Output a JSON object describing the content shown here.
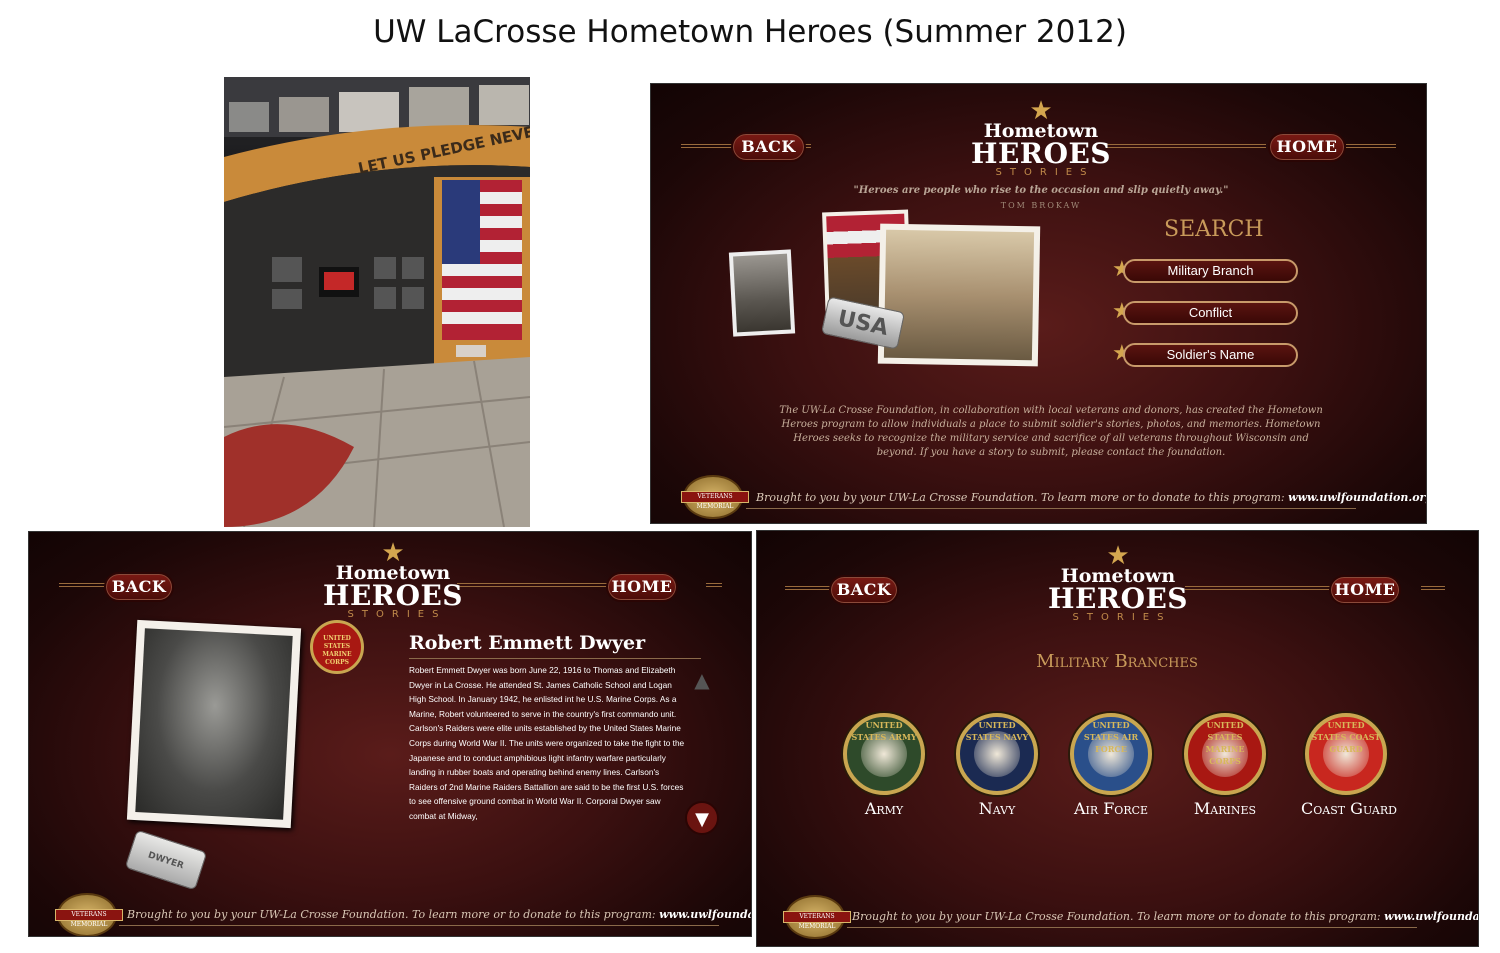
{
  "page_title": "UW LaCrosse Hometown Heroes (Summer 2012)",
  "lobby_photo": {
    "wall_text": "LET US PLEDGE NEVER TO"
  },
  "logo": {
    "line1": "Hometown",
    "line2": "HEROES",
    "line3": "STORIES"
  },
  "nav": {
    "back_label": "BACK",
    "home_label": "HOME"
  },
  "search_screen": {
    "quote": "\"Heroes are people who rise to the occasion and slip quietly away.\"",
    "quote_author": "TOM BROKAW",
    "search_title": "SEARCH",
    "buttons": [
      "Military Branch",
      "Conflict",
      "Soldier's Name"
    ],
    "dog_tag_text": "USA",
    "description": "The UW-La Crosse Foundation, in collaboration with local veterans and donors, has created the Hometown Heroes program to allow individuals a place to submit soldier's stories, photos, and memories. Hometown Heroes seeks to recognize the military service and sacrifice of all veterans throughout Wisconsin and beyond. If you have a story to submit, please contact the foundation."
  },
  "footer": {
    "text": "Brought to you by your UW-La Crosse Foundation. To learn more or to donate to this program:",
    "url": "www.uwlfoundation.org",
    "seal_text": "VETERANS MEMORIAL"
  },
  "bio_screen": {
    "name": "Robert Emmett Dwyer",
    "bio": "Robert Emmett Dwyer was born June 22, 1916 to Thomas and Elizabeth Dwyer in La Crosse. He attended St. James Catholic School and Logan High School. In January 1942, he enlisted int he U.S. Marine Corps. As a Marine, Robert volunteered to serve in the country's first commando unit. Carlson's Raiders were elite units established by the United States Marine Corps during World War II. The units were organized to take the fight to the Japanese and to conduct amphibious light infantry warfare particularly landing in rubber boats and operating behind enemy lines. Carlson's Raiders of 2nd Marine Raiders Battallion are said to be the first U.S. forces to see offensive ground combat in World War II. Corporal Dwyer saw combat at Midway,",
    "dog_tag_text": "DWYER",
    "emblem_text": "UNITED STATES MARINE CORPS",
    "up_arrow": "▲",
    "down_arrow": "▼"
  },
  "branches_screen": {
    "title": "Military Branches",
    "branches": [
      {
        "label": "Army",
        "ring_text": "UNITED STATES ARMY",
        "color": "#2e4a2a"
      },
      {
        "label": "Navy",
        "ring_text": "UNITED STATES NAVY",
        "color": "#1b2a52"
      },
      {
        "label": "Air Force",
        "ring_text": "UNITED STATES AIR FORCE",
        "color": "#2a4f8a"
      },
      {
        "label": "Marines",
        "ring_text": "UNITED STATES MARINE CORPS",
        "color": "#a81812"
      },
      {
        "label": "Coast Guard",
        "ring_text": "UNITED STATES COAST GUARD",
        "color": "#c8271f"
      }
    ]
  }
}
